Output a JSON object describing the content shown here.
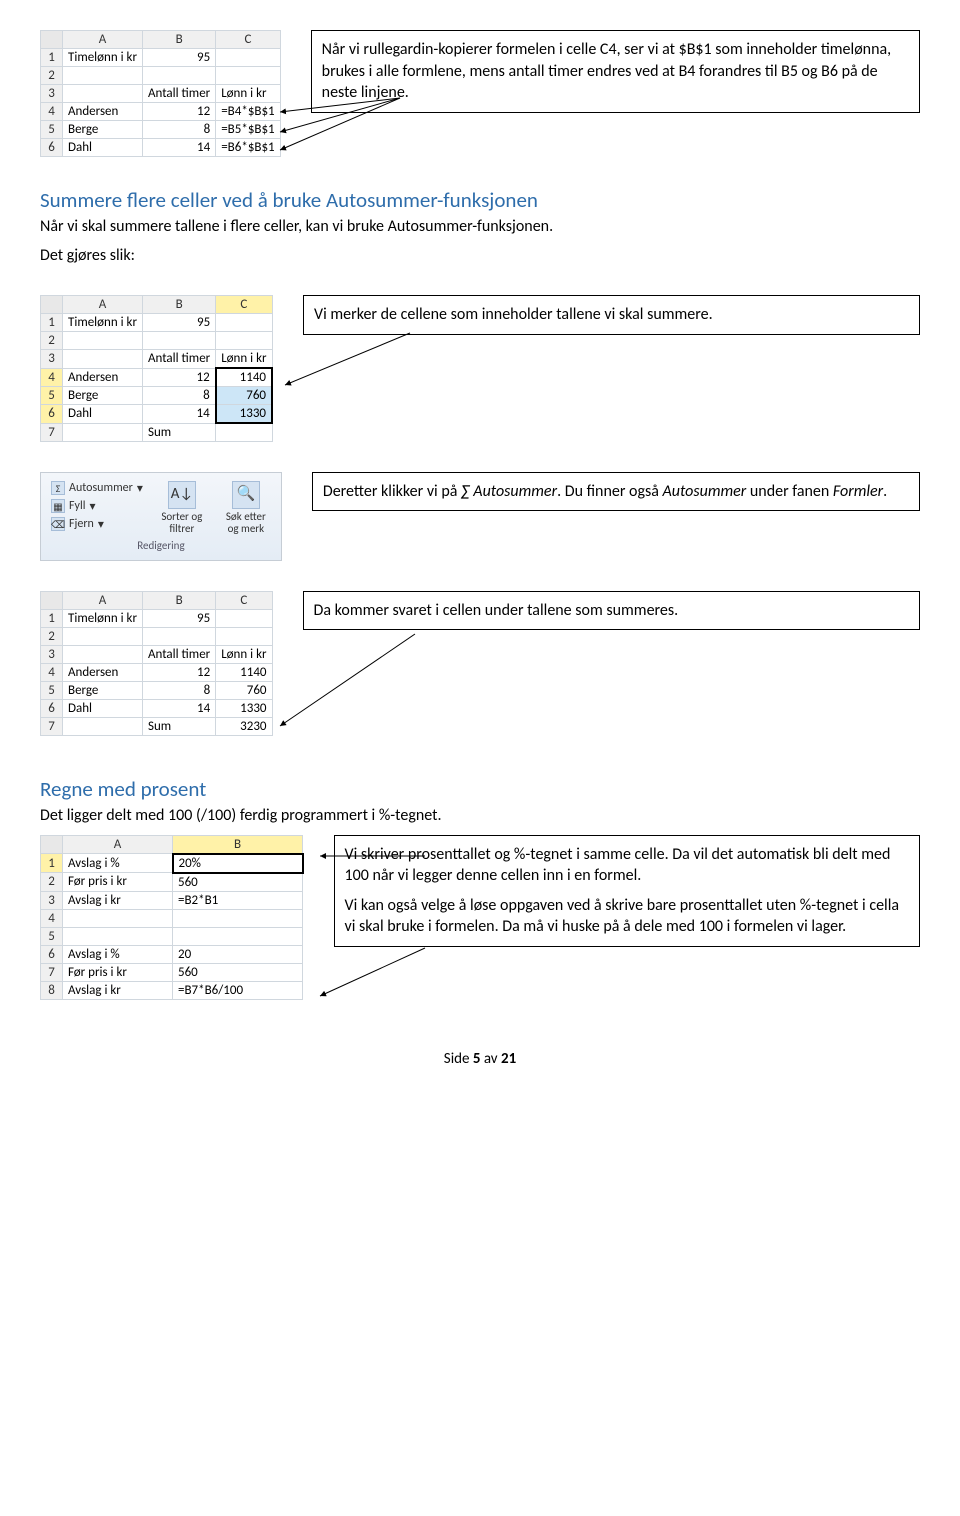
{
  "tbl1": {
    "cols": [
      "A",
      "B",
      "C"
    ],
    "rows": [
      {
        "n": "1",
        "a": "Timelønn i kr",
        "b": "95",
        "c": ""
      },
      {
        "n": "2",
        "a": "",
        "b": "",
        "c": ""
      },
      {
        "n": "3",
        "a": "",
        "b": "Antall timer",
        "c": "Lønn i kr"
      },
      {
        "n": "4",
        "a": "Andersen",
        "b": "12",
        "c": "=B4*$B$1"
      },
      {
        "n": "5",
        "a": "Berge",
        "b": "8",
        "c": "=B5*$B$1"
      },
      {
        "n": "6",
        "a": "Dahl",
        "b": "14",
        "c": "=B6*$B$1"
      }
    ]
  },
  "callout1": "Når vi rullegardin-kopierer formelen i celle C4, ser vi at $B$1 som inneholder timelønna, brukes i alle formlene, mens antall timer endres ved at B4 forandres til B5 og B6 på de neste linjene.",
  "sec2": {
    "title": "Summere flere celler ved å bruke Autosummer-funksjonen",
    "text": "Når vi skal summere tallene i flere celler, kan vi bruke Autosummer-funksjonen.",
    "sub": "Det gjøres slik:"
  },
  "tbl2": {
    "cols": [
      "A",
      "B",
      "C"
    ],
    "rows": [
      {
        "n": "1",
        "a": "Timelønn i kr",
        "b": "95",
        "c": ""
      },
      {
        "n": "2",
        "a": "",
        "b": "",
        "c": ""
      },
      {
        "n": "3",
        "a": "",
        "b": "Antall timer",
        "c": "Lønn i kr"
      },
      {
        "n": "4",
        "a": "Andersen",
        "b": "12",
        "c": "1140",
        "sel": true
      },
      {
        "n": "5",
        "a": "Berge",
        "b": "8",
        "c": "760",
        "sel": true
      },
      {
        "n": "6",
        "a": "Dahl",
        "b": "14",
        "c": "1330",
        "sel": true
      },
      {
        "n": "7",
        "a": "",
        "b": "Sum",
        "c": ""
      }
    ]
  },
  "callout2": "Vi merker de cellene som inneholder tallene vi skal summere.",
  "ribbon": {
    "autosum": "Autosummer",
    "fill": "Fyll",
    "clear": "Fjern",
    "sort": "Sorter og filtrer",
    "find": "Søk etter og merk",
    "group": "Redigering"
  },
  "callout3": {
    "t1": "Deretter klikker vi på ",
    "i1": "∑ Autosummer",
    "t2": ". Du finner også ",
    "i2": "Autosummer",
    "t3": " under fanen ",
    "i3": "Formler",
    "t4": "."
  },
  "tbl3": {
    "cols": [
      "A",
      "B",
      "C"
    ],
    "rows": [
      {
        "n": "1",
        "a": "Timelønn i kr",
        "b": "95",
        "c": ""
      },
      {
        "n": "2",
        "a": "",
        "b": "",
        "c": ""
      },
      {
        "n": "3",
        "a": "",
        "b": "Antall timer",
        "c": "Lønn i kr"
      },
      {
        "n": "4",
        "a": "Andersen",
        "b": "12",
        "c": "1140"
      },
      {
        "n": "5",
        "a": "Berge",
        "b": "8",
        "c": "760"
      },
      {
        "n": "6",
        "a": "Dahl",
        "b": "14",
        "c": "1330"
      },
      {
        "n": "7",
        "a": "",
        "b": "Sum",
        "c": "3230"
      }
    ]
  },
  "callout4": "Da kommer svaret i cellen under tallene som summeres.",
  "sec3": {
    "title": "Regne med prosent",
    "text": "Det ligger delt med 100 (/100) ferdig programmert i %-tegnet."
  },
  "tbl4": {
    "cols": [
      "A",
      "B"
    ],
    "rows": [
      {
        "n": "1",
        "a": "Avslag i %",
        "b": "20%",
        "active": true
      },
      {
        "n": "2",
        "a": "Før pris i kr",
        "b": "560"
      },
      {
        "n": "3",
        "a": "Avslag i kr",
        "b": "=B2*B1"
      },
      {
        "n": "4",
        "a": "",
        "b": ""
      },
      {
        "n": "5",
        "a": "",
        "b": ""
      },
      {
        "n": "6",
        "a": "Avslag i %",
        "b": "20"
      },
      {
        "n": "7",
        "a": "Før pris i kr",
        "b": "560"
      },
      {
        "n": "8",
        "a": "Avslag i kr",
        "b": "=B7*B6/100"
      }
    ]
  },
  "callout5": {
    "p1": "Vi skriver prosenttallet og %-tegnet i samme celle. Da vil det automatisk bli delt med 100 når vi legger denne cellen inn i en formel.",
    "p2": "Vi kan også velge å løse oppgaven ved å skrive bare prosenttallet uten %-tegnet i cella vi skal bruke i formelen. Da må vi huske på å dele med 100 i formelen vi lager."
  },
  "footer": {
    "pre": "Side ",
    "num": "5",
    "mid": " av ",
    "tot": "21"
  }
}
